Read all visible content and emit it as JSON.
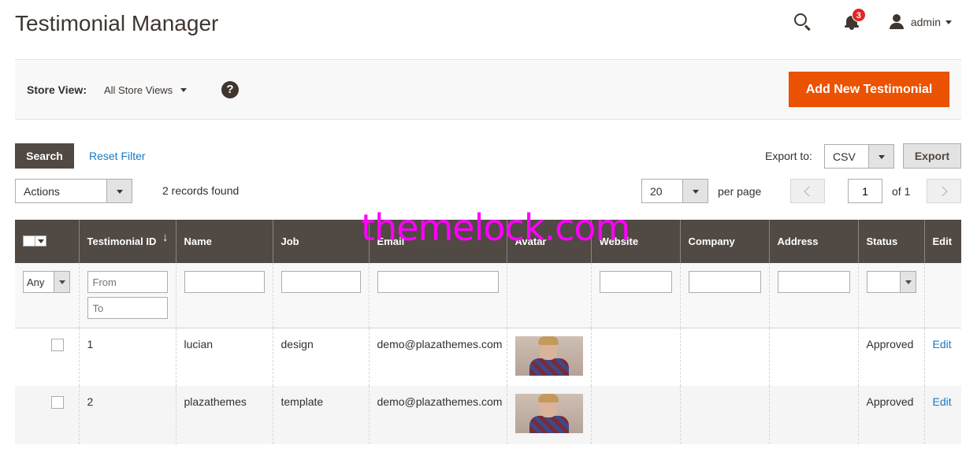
{
  "page": {
    "title": "Testimonial Manager"
  },
  "header": {
    "notifications_count": "3",
    "user_name": "admin",
    "icons": [
      "search-icon",
      "bell-icon",
      "user-icon"
    ]
  },
  "store_bar": {
    "label": "Store View:",
    "value": "All Store Views",
    "help_glyph": "?",
    "add_button": "Add New Testimonial"
  },
  "toolbar": {
    "search_label": "Search",
    "reset_label": "Reset Filter",
    "export_label": "Export to:",
    "export_format": "CSV",
    "export_button": "Export",
    "actions_label": "Actions",
    "records_found": "2 records found",
    "per_page_value": "20",
    "per_page_label": "per page",
    "current_page": "1",
    "page_of": "of 1"
  },
  "grid": {
    "columns": [
      "",
      "Testimonial ID",
      "Name",
      "Job",
      "Email",
      "Avatar",
      "Website",
      "Company",
      "Address",
      "Status",
      "Edit"
    ],
    "sort_arrow": "↓",
    "filters": {
      "any": "Any",
      "from_placeholder": "From",
      "to_placeholder": "To"
    },
    "rows": [
      {
        "id": "1",
        "name": "lucian",
        "job": "design",
        "email": "demo@plazathemes.com",
        "website": "",
        "company": "",
        "address": "",
        "status": "Approved",
        "edit": "Edit"
      },
      {
        "id": "2",
        "name": "plazathemes",
        "job": "template",
        "email": "demo@plazathemes.com",
        "website": "",
        "company": "",
        "address": "",
        "status": "Approved",
        "edit": "Edit"
      }
    ]
  },
  "watermark": "themelock.com",
  "colors": {
    "header_bg": "#514943",
    "accent": "#eb5202",
    "link": "#1979c3",
    "watermark": "#ff00ff"
  }
}
